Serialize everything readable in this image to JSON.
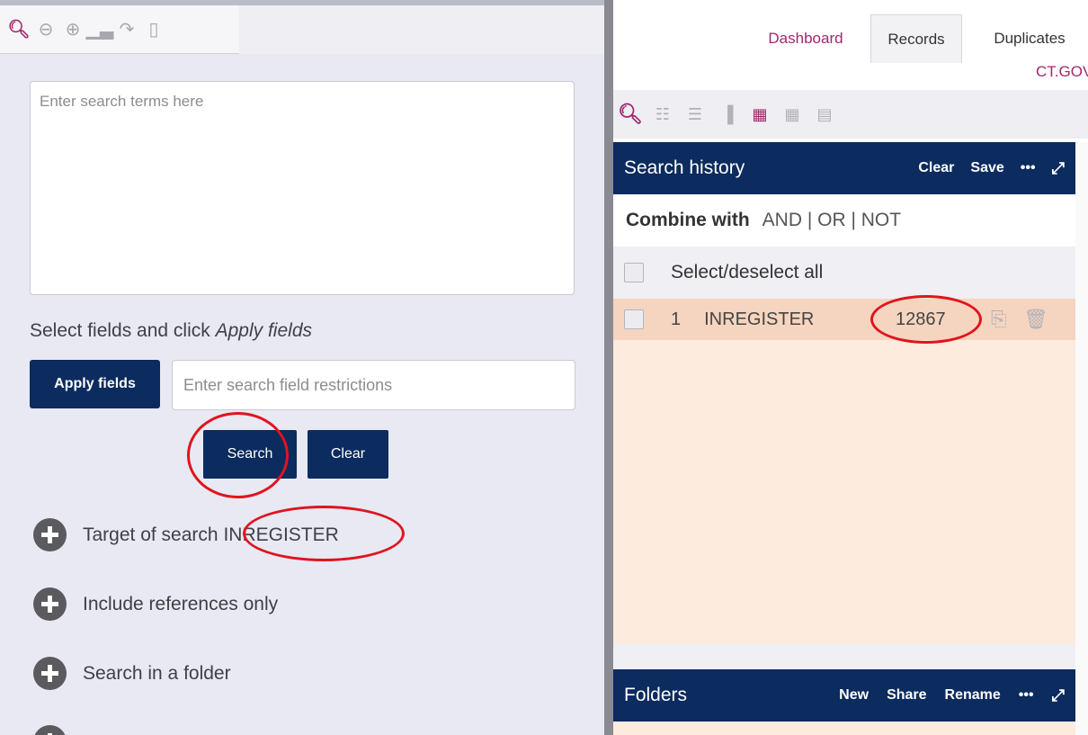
{
  "left_toolbar": {
    "icons": [
      "search-icon",
      "zoom-out-icon",
      "zoom-in-icon",
      "chart-icon",
      "redo-icon",
      "document-icon"
    ]
  },
  "search": {
    "placeholder": "Enter search terms here"
  },
  "fields": {
    "instruction_prefix": "Select fields and click",
    "instruction_emphasis": "Apply fields",
    "apply_label": "Apply fields",
    "restriction_placeholder": "Enter search field restrictions"
  },
  "buttons": {
    "search_label": "Search",
    "clear_label": "Clear"
  },
  "options": {
    "target": {
      "label": "Target of search",
      "value": "INREGISTER"
    },
    "references": {
      "label": "Include references only"
    },
    "folder": {
      "label": "Search in a folder"
    }
  },
  "nav": {
    "dashboard": "Dashboard",
    "records": "Records",
    "duplicates": "Duplicates",
    "database": "CT.GOV"
  },
  "right_toolbar": {
    "icons": [
      "search-icon",
      "search-preview-icon",
      "list-view-icon",
      "split-view-icon",
      "grid-view-icon",
      "tile-view-icon",
      "report-icon"
    ]
  },
  "search_history": {
    "title": "Search history",
    "clear": "Clear",
    "save": "Save",
    "more": "•••",
    "combine_label": "Combine with",
    "combine_ops": "AND | OR | NOT",
    "select_all": "Select/deselect all",
    "rows": [
      {
        "num": "1",
        "term": "INREGISTER",
        "count": "12867"
      }
    ]
  },
  "folders": {
    "title": "Folders",
    "new": "New",
    "share": "Share",
    "rename": "Rename",
    "more": "•••"
  },
  "colors": {
    "accent": "#a0286c",
    "navy": "#0c2b5e",
    "highlight_row": "#f5d5bf",
    "annotation": "#e0141e"
  }
}
